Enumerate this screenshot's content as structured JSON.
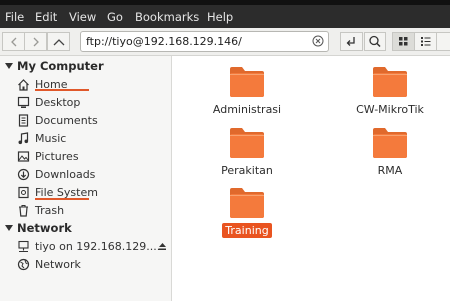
{
  "menubar": {
    "items": [
      "File",
      "Edit",
      "View",
      "Go",
      "Bookmarks",
      "Help"
    ]
  },
  "address": {
    "value": "ftp://tiyo@192.168.129.146/"
  },
  "sidebar": {
    "sections": [
      {
        "title": "My Computer",
        "items": [
          {
            "label": "Home",
            "icon": "home-icon"
          },
          {
            "label": "Desktop",
            "icon": "desktop-icon"
          },
          {
            "label": "Documents",
            "icon": "documents-icon"
          },
          {
            "label": "Music",
            "icon": "music-icon"
          },
          {
            "label": "Pictures",
            "icon": "pictures-icon"
          },
          {
            "label": "Downloads",
            "icon": "downloads-icon"
          },
          {
            "label": "File System",
            "icon": "file-system-icon"
          },
          {
            "label": "Trash",
            "icon": "trash-icon"
          }
        ]
      },
      {
        "title": "Network",
        "items": [
          {
            "label": "tiyo on 192.168.129....",
            "icon": "network-share-icon"
          },
          {
            "label": "Network",
            "icon": "globe-icon"
          }
        ]
      }
    ]
  },
  "folders": [
    {
      "name": "Administrasi",
      "selected": false
    },
    {
      "name": "CW-MikroTik",
      "selected": false
    },
    {
      "name": "Perakitan",
      "selected": false
    },
    {
      "name": "RMA",
      "selected": false
    },
    {
      "name": "Training",
      "selected": true
    }
  ],
  "colors": {
    "accent": "#e95420",
    "folder": "#f47a3c",
    "folder_tab": "#e0692c",
    "menubar_bg": "#2c2c2c"
  }
}
